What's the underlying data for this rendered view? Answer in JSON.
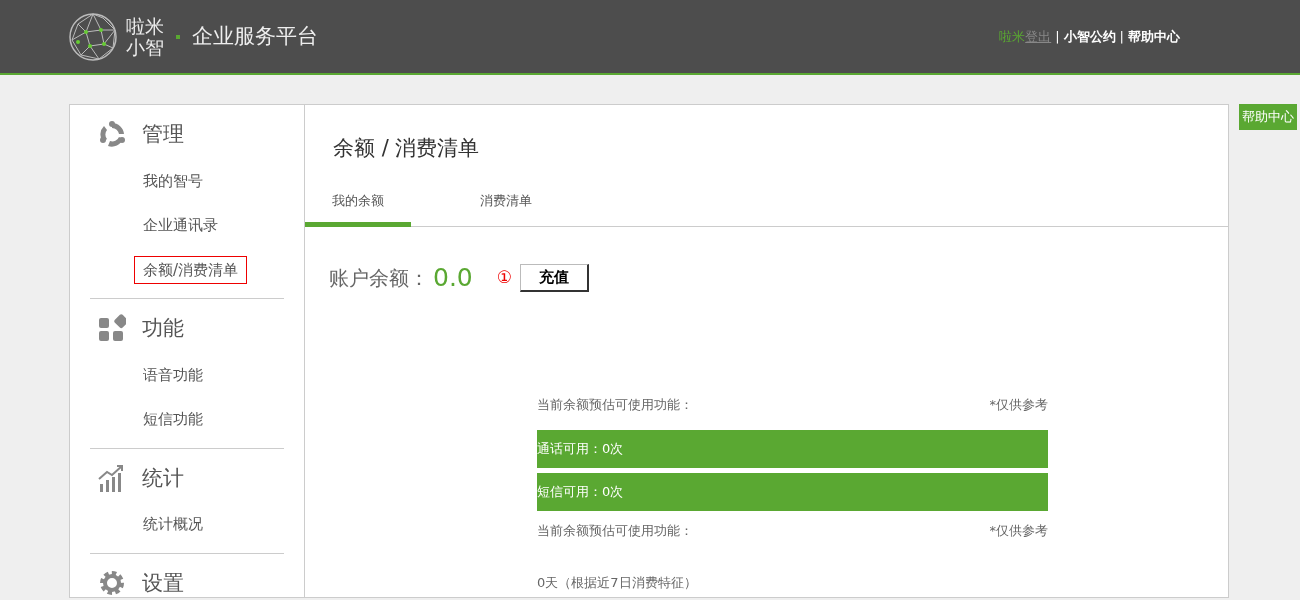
{
  "header": {
    "logo_text": [
      "啦米",
      "小智"
    ],
    "platform": "企业服务平台",
    "user": "啦米",
    "logout": "登出",
    "links": [
      {
        "sep": "|",
        "label": "小智公约"
      },
      {
        "sep": "|",
        "label": "帮助中心"
      }
    ]
  },
  "help_button": "帮助中心",
  "sidebar": {
    "sections": [
      {
        "kind": "manage",
        "title": "管理",
        "items": [
          {
            "label": "我的智号",
            "selected": false
          },
          {
            "label": "企业通讯录",
            "selected": false
          },
          {
            "label": "余额/消费清单",
            "selected": true
          }
        ]
      },
      {
        "kind": "feature",
        "title": "功能",
        "items": [
          {
            "label": "语音功能",
            "selected": false
          },
          {
            "label": "短信功能",
            "selected": false
          }
        ]
      },
      {
        "kind": "stats",
        "title": "统计",
        "items": [
          {
            "label": "统计概况",
            "selected": false
          }
        ]
      },
      {
        "kind": "settings",
        "title": "设置"
      }
    ]
  },
  "page": {
    "title": "余额 / 消费清单",
    "tabs": [
      {
        "label": "我的余额",
        "selected": true
      },
      {
        "label": "消费清单",
        "selected": false
      }
    ],
    "balance": {
      "label": "账户余额：",
      "value": "0.0",
      "marker": "①",
      "recharge": "充值"
    },
    "estimate": {
      "heading": "当前余额预估可使用功能：",
      "note": "*仅供参考",
      "bars": [
        "通话可用：0次",
        "短信可用：0次"
      ]
    },
    "estimate2": {
      "heading": "当前余额预估可使用功能：",
      "note": "*仅供参考",
      "days": "0天（根据近7日消费特征）"
    }
  }
}
